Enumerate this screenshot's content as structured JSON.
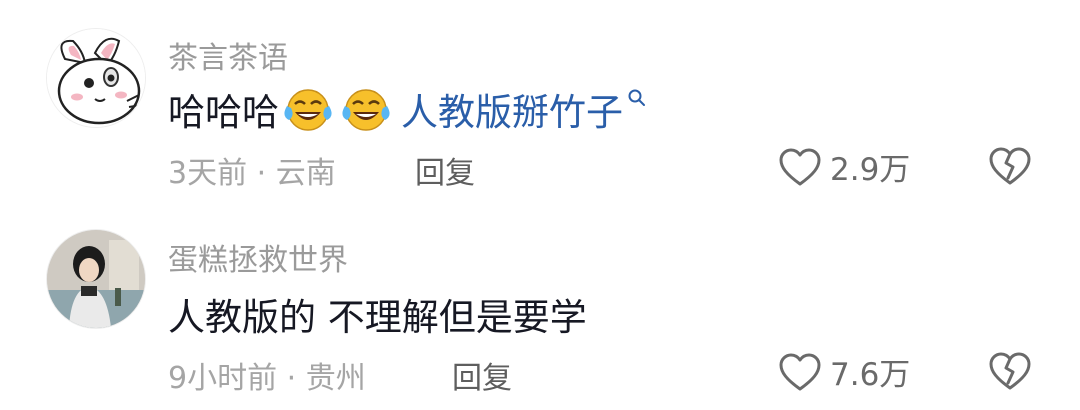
{
  "comments": [
    {
      "username": "茶言茶语",
      "text_prefix": "哈哈哈",
      "emojis": [
        "laugh-cry-emoji",
        "laugh-cry-emoji"
      ],
      "link_text": "人教版掰竹子",
      "time_location": "3天前 · 云南",
      "reply_label": "回复",
      "likes": "2.9万"
    },
    {
      "username": "蛋糕拯救世界",
      "text": "人教版的 不理解但是要学",
      "time_location": "9小时前 · 贵州",
      "reply_label": "回复",
      "likes": "7.6万"
    }
  ],
  "colors": {
    "username": "#9a9a9a",
    "text": "#161823",
    "link": "#2a5ea9",
    "meta": "#a5a5a5"
  }
}
